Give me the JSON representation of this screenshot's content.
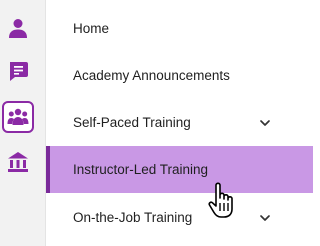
{
  "colors": {
    "accent": "#8b2aa5",
    "active_bg": "#c998e5",
    "active_bar": "#7a2a9a"
  },
  "rail": {
    "icons": [
      "person-icon",
      "chat-icon",
      "group-icon",
      "institution-icon"
    ],
    "active_index": 2
  },
  "menu": {
    "items": [
      {
        "label": "Home",
        "has_chevron": false
      },
      {
        "label": "Academy Announcements",
        "has_chevron": false
      },
      {
        "label": "Self-Paced Training",
        "has_chevron": true
      },
      {
        "label": "Instructor-Led Training",
        "has_chevron": false,
        "active": true
      },
      {
        "label": "On-the-Job Training",
        "has_chevron": true
      }
    ]
  }
}
